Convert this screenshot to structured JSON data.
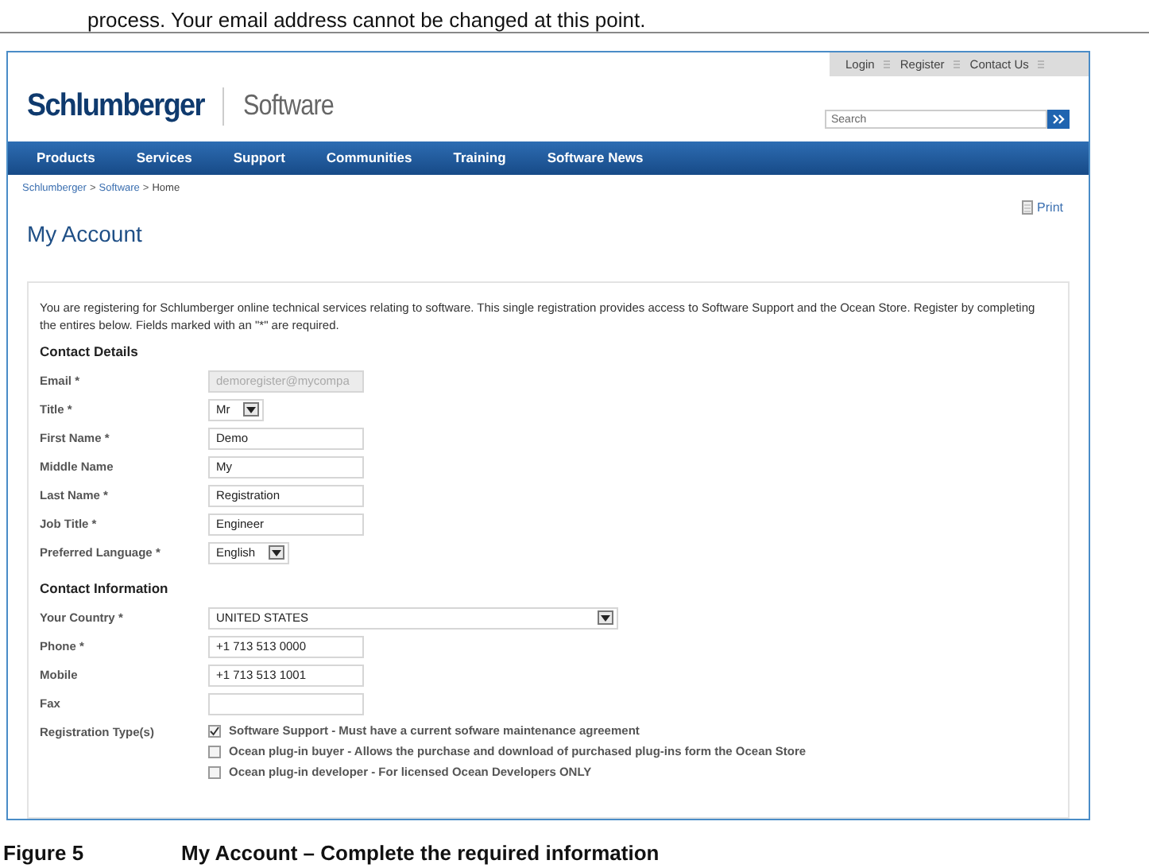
{
  "intro_line": "process. Your email address cannot be changed at this point.",
  "screenshot": {
    "utility_links": [
      "Login",
      "Register",
      "Contact Us"
    ],
    "logo": {
      "brand": "Schlumberger",
      "product": "Software"
    },
    "search": {
      "placeholder": "Search"
    },
    "nav": [
      "Products",
      "Services",
      "Support",
      "Communities",
      "Training",
      "Software News"
    ],
    "breadcrumb": {
      "separator": ">",
      "items": [
        {
          "label": "Schlumberger",
          "current": false
        },
        {
          "label": "Software",
          "current": false
        },
        {
          "label": "Home",
          "current": true
        }
      ]
    },
    "print": "Print",
    "title": "My Account",
    "intro": "You are registering for Schlumberger online technical services relating to software. This single registration provides access to Software Support and the Ocean Store. Register by completing the entires below. Fields marked with an \"*\" are required.",
    "sections": [
      {
        "heading": "Contact Details",
        "fields": [
          {
            "label": "Email *",
            "kind": "text",
            "value": "demoregister@mycompa",
            "disabled": true
          },
          {
            "label": "Title *",
            "kind": "select",
            "value": "Mr"
          },
          {
            "label": "First Name *",
            "kind": "text",
            "value": "Demo",
            "disabled": false
          },
          {
            "label": "Middle Name",
            "kind": "text",
            "value": "My",
            "disabled": false
          },
          {
            "label": "Last Name *",
            "kind": "text",
            "value": "Registration",
            "disabled": false
          },
          {
            "label": "Job Title *",
            "kind": "text",
            "value": "Engineer",
            "disabled": false
          },
          {
            "label": "Preferred Language *",
            "kind": "select",
            "value": "English"
          }
        ]
      },
      {
        "heading": "Contact Information",
        "fields": [
          {
            "label": "Your Country *",
            "kind": "wide_select",
            "value": "UNITED STATES"
          },
          {
            "label": "Phone *",
            "kind": "text",
            "value": "+1 713 513 0000",
            "disabled": false
          },
          {
            "label": "Mobile",
            "kind": "text",
            "value": "+1 713 513 1001",
            "disabled": false
          },
          {
            "label": "Fax",
            "kind": "text",
            "disabled": false
          },
          {
            "label": "Registration Type(s)",
            "kind": "checkboxes",
            "options": [
              {
                "label": "Software Support - Must have a current sofware maintenance agreement",
                "checked": true
              },
              {
                "label": "Ocean plug-in buyer - Allows the purchase and download of purchased plug-ins form the Ocean Store",
                "checked": false
              },
              {
                "label": "Ocean plug-in developer - For licensed Ocean Developers ONLY",
                "checked": false
              }
            ]
          }
        ]
      }
    ]
  },
  "caption": {
    "number": "Figure 5",
    "text": "My Account – Complete the required information"
  }
}
